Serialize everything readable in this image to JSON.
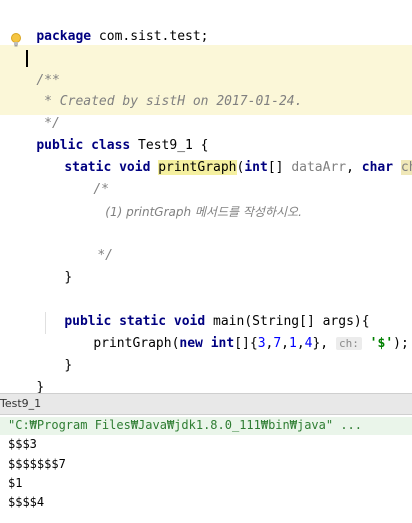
{
  "editor": {
    "line_package": "package com.sist.test;",
    "doc_open": "/**",
    "doc_created": " * Created by sistH on 2017-01-24.",
    "doc_close": " */",
    "class_decl": {
      "kw": "public class",
      "name": " Test9_1 {"
    },
    "method_print": {
      "kw": "static void",
      "name": "printGraph",
      "open": "(",
      "type1": "int",
      "arr": "[] ",
      "p1": "dataArr",
      "comma": ", ",
      "type2": "char",
      "p2": "ch",
      "close": "){"
    },
    "comment_open": "/*",
    "comment_text": "(1) printGraph 메서드를 작성하시오.",
    "comment_close": "*/",
    "brace1": "}",
    "method_main": {
      "kw": "public static void",
      "sig": " main(String[] args){"
    },
    "call": {
      "fn": "printGraph(",
      "kw_new": "new",
      "type": "int",
      "open": "[]{",
      "nums": [
        "3",
        "7",
        "1",
        "4"
      ],
      "close": "},",
      "hint": "ch:",
      "char": "'$'",
      "end": ");"
    },
    "brace2": "}",
    "brace3": "}"
  },
  "console": {
    "tab_label": "Test9_1",
    "command": "\"C:₩Program Files₩Java₩jdk1.8.0_111₩bin₩java\" ...",
    "output": [
      "$$$3",
      "$$$$$$$7",
      "$1",
      "$$$$4"
    ]
  },
  "colors": {
    "keyword": "#000080",
    "comment": "#808080",
    "number": "#0000ff",
    "string": "#008000",
    "doc_background": "#fbf7d8"
  },
  "icons": [
    "lightbulb-icon"
  ]
}
